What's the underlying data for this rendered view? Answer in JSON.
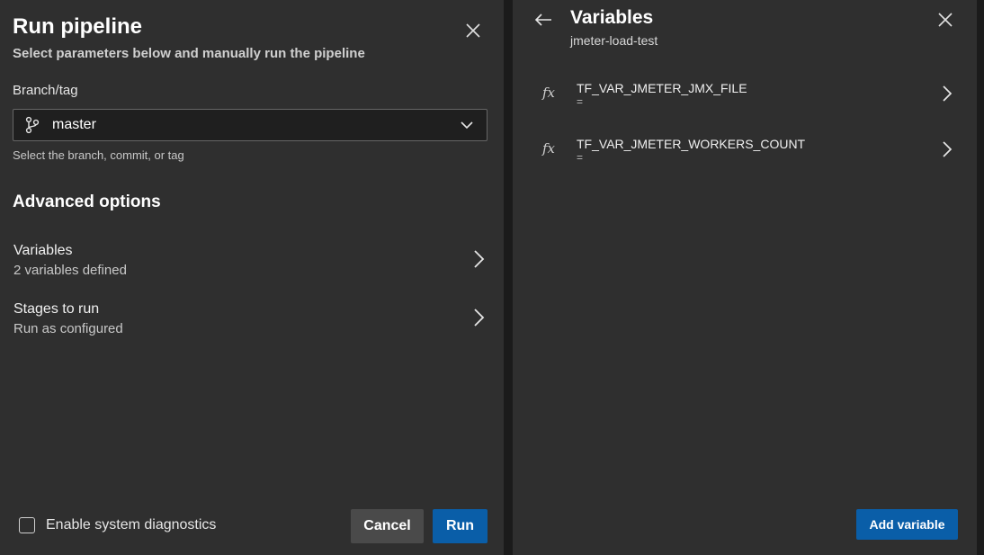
{
  "run_panel": {
    "title": "Run pipeline",
    "subtitle": "Select parameters below and manually run the pipeline",
    "branch_label": "Branch/tag",
    "branch_value": "master",
    "branch_help": "Select the branch, commit, or tag",
    "advanced_title": "Advanced options",
    "options": [
      {
        "label": "Variables",
        "description": "2 variables defined"
      },
      {
        "label": "Stages to run",
        "description": "Run as configured"
      }
    ],
    "diagnostics_label": "Enable system diagnostics",
    "cancel_label": "Cancel",
    "run_label": "Run"
  },
  "variables_panel": {
    "title": "Variables",
    "subtitle": "jmeter-load-test",
    "variables": [
      {
        "name": "TF_VAR_JMETER_JMX_FILE",
        "value": "="
      },
      {
        "name": "TF_VAR_JMETER_WORKERS_COUNT",
        "value": "="
      }
    ],
    "add_label": "Add variable"
  },
  "colors": {
    "panel_bg": "#2f2f2f",
    "primary_button": "#0a5ea8",
    "secondary_button": "#4a4a4a",
    "input_bg": "#1f1f1f"
  },
  "icons": {
    "close": "close-icon",
    "branch": "git-branch-icon",
    "dropdown": "chevron-down-icon",
    "row_chevron": "chevron-right-icon",
    "back": "arrow-left-icon",
    "variable": "fx-icon"
  }
}
